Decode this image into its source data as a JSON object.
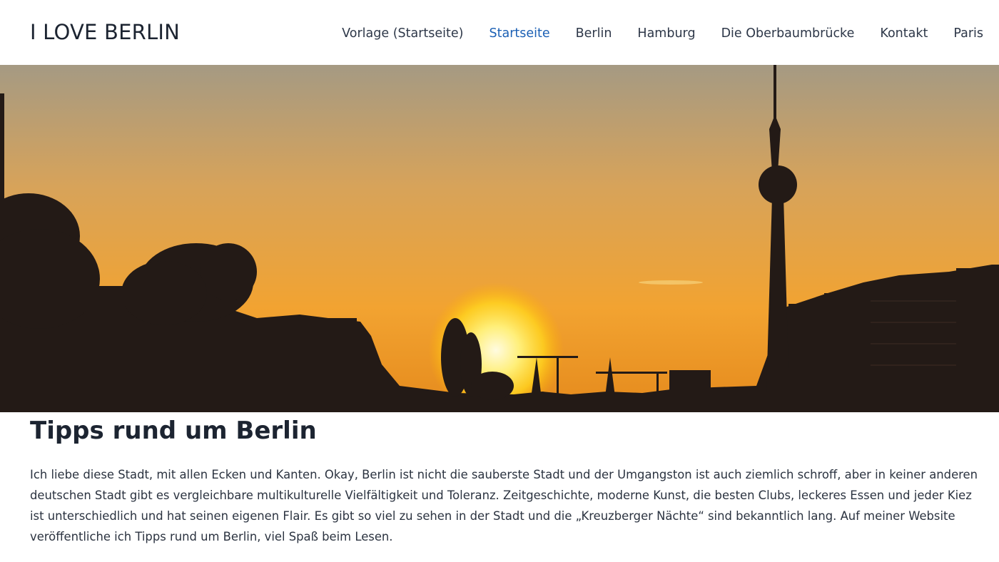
{
  "site": {
    "brand": "I LOVE BERLIN"
  },
  "nav": {
    "items": [
      {
        "label": "Vorlage (Startseite)",
        "active": false
      },
      {
        "label": "Startseite",
        "active": true
      },
      {
        "label": "Berlin",
        "active": false
      },
      {
        "label": "Hamburg",
        "active": false
      },
      {
        "label": "Die Oberbaumbrücke",
        "active": false
      },
      {
        "label": "Kontakt",
        "active": false
      },
      {
        "label": "Paris",
        "active": false
      }
    ]
  },
  "colors": {
    "active_link": "#1a5fb4",
    "text": "#2b3340",
    "sky_top": "#a59a83",
    "sky_bottom": "#f3a230",
    "sun": "#ffe04a"
  },
  "main": {
    "title": "Tipps rund um Berlin",
    "intro": "Ich liebe diese Stadt, mit allen Ecken und Kanten. Okay, Berlin ist nicht die sauberste Stadt und der Umgangston ist auch ziemlich schroff, aber in keiner anderen deutschen Stadt gibt es vergleichbare multikulturelle Vielfältigkeit und Toleranz. Zeitgeschichte, moderne Kunst, die besten Clubs, leckeres Essen und jeder Kiez ist unterschiedlich und hat seinen eigenen Flair. Es gibt so viel zu sehen in der Stadt und die „Kreuzberger Nächte“ sind bekanntlich lang. Auf meiner Website veröffentliche ich Tipps rund um Berlin, viel Spaß beim Lesen."
  }
}
